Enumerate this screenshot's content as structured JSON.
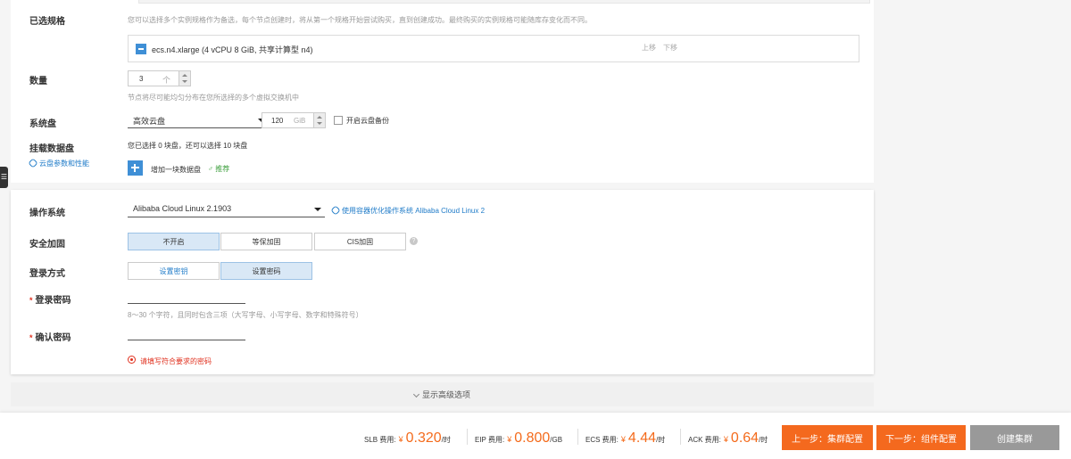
{
  "spec": {
    "label": "已选规格",
    "hint": "您可以选择多个实例规格作为备选，每个节点创建时，将从第一个规格开始尝试购买，直到创建成功。最终购买的实例规格可能随库存变化而不同。",
    "item": "ecs.n4.xlarge (4 vCPU 8 GiB, 共享计算型 n4)",
    "move_up": "上移",
    "move_down": "下移"
  },
  "quantity": {
    "label": "数量",
    "value": "3",
    "unit": "个",
    "hint": "节点将尽可能均匀分布在您所选择的多个虚拟交换机中"
  },
  "system_disk": {
    "label": "系统盘",
    "type": "高效云盘",
    "size": "120",
    "unit": "GiB",
    "backup_label": "开启云盘备份"
  },
  "data_disk": {
    "label": "挂载数据盘",
    "link": "云盘参数和性能",
    "summary": "您已选择 0 块盘，还可以选择 10 块盘",
    "add_label": "增加一块数据盘",
    "recommend": "推荐"
  },
  "os": {
    "label": "操作系统",
    "value": "Alibaba Cloud Linux 2.1903",
    "link": "使用容器优化操作系统 Alibaba Cloud Linux 2"
  },
  "security": {
    "label": "安全加固",
    "options": [
      "不开启",
      "等保加固",
      "CIS加固"
    ],
    "selected": "不开启",
    "help": "?"
  },
  "login": {
    "label": "登录方式",
    "options": [
      "设置密钥",
      "设置密码"
    ],
    "selected": "设置密码",
    "password_label": "登录密码",
    "password_hint": "8～30 个字符，且同时包含三项（大写字母、小写字母、数字和特殊符号）",
    "confirm_label": "确认密码",
    "error": "请填写符合要求的密码",
    "required_mark": "*"
  },
  "advanced": {
    "label": "显示高级选项"
  },
  "side_tab": {
    "glyph": "☰"
  },
  "footer": {
    "fees": [
      {
        "label": "SLB 费用:",
        "currency": "¥",
        "amount": "0.320",
        "unit": "/时"
      },
      {
        "label": "EIP 费用:",
        "currency": "¥",
        "amount": "0.800",
        "unit": "/GB"
      },
      {
        "label": "ECS 费用:",
        "currency": "¥",
        "amount": "4.44",
        "unit": "/时"
      },
      {
        "label": "ACK 费用:",
        "currency": "¥",
        "amount": "0.64",
        "unit": "/时"
      }
    ],
    "prev_button": "上一步：集群配置",
    "next_button": "下一步：组件配置",
    "create_button": "创建集群"
  },
  "colors": {
    "accent": "#3f8fd6",
    "link": "#1f7bc8",
    "price": "#f46b1c",
    "error": "#e0301e"
  }
}
